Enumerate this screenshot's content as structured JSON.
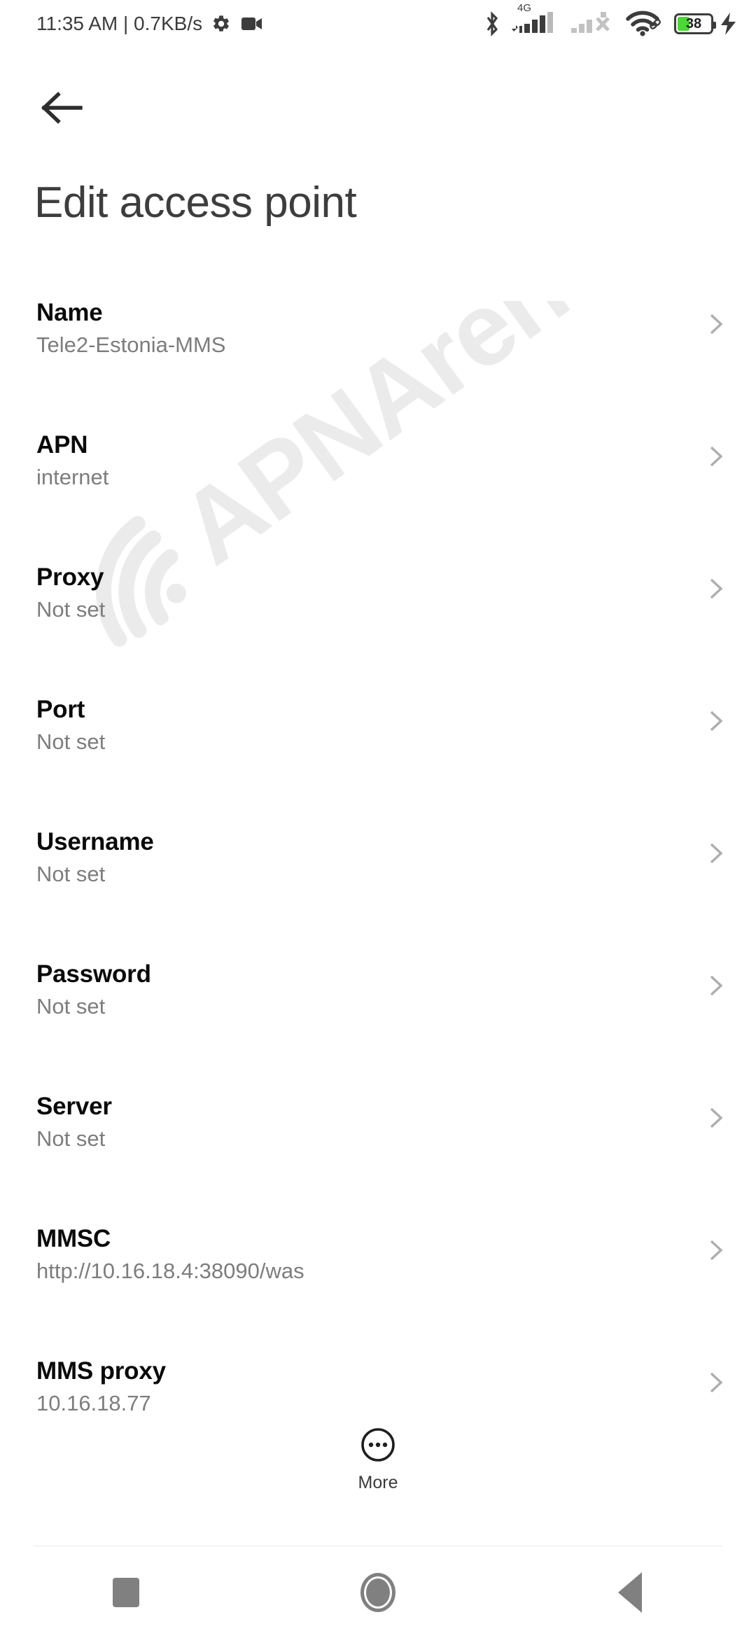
{
  "status_bar": {
    "clock": "11:35 AM | 0.7KB/s",
    "network_label": "4G",
    "battery_percent": "38",
    "battery_level": 38,
    "battery_color": "#4CD637",
    "icons": [
      "gear-icon",
      "camcorder-icon",
      "bluetooth-icon",
      "signal-sim1-icon",
      "signal-sim2-no-service-icon",
      "wifi-icon",
      "battery-icon",
      "charging-bolt-icon"
    ]
  },
  "header": {
    "back_label": "Back",
    "title": "Edit access point"
  },
  "watermark": {
    "text": "APNArena",
    "color": "#EBEBEB"
  },
  "list": {
    "rows": [
      {
        "label": "Name",
        "value": "Tele2-Estonia-MMS"
      },
      {
        "label": "APN",
        "value": "internet"
      },
      {
        "label": "Proxy",
        "value": "Not set"
      },
      {
        "label": "Port",
        "value": "Not set"
      },
      {
        "label": "Username",
        "value": "Not set"
      },
      {
        "label": "Password",
        "value": "Not set"
      },
      {
        "label": "Server",
        "value": "Not set"
      },
      {
        "label": "MMSC",
        "value": "http://10.16.18.4:38090/was"
      },
      {
        "label": "MMS proxy",
        "value": "10.16.18.77"
      }
    ]
  },
  "more_button": {
    "label": "More"
  },
  "nav_bar": {
    "recents_label": "Recents",
    "home_label": "Home",
    "back_label": "Back"
  }
}
